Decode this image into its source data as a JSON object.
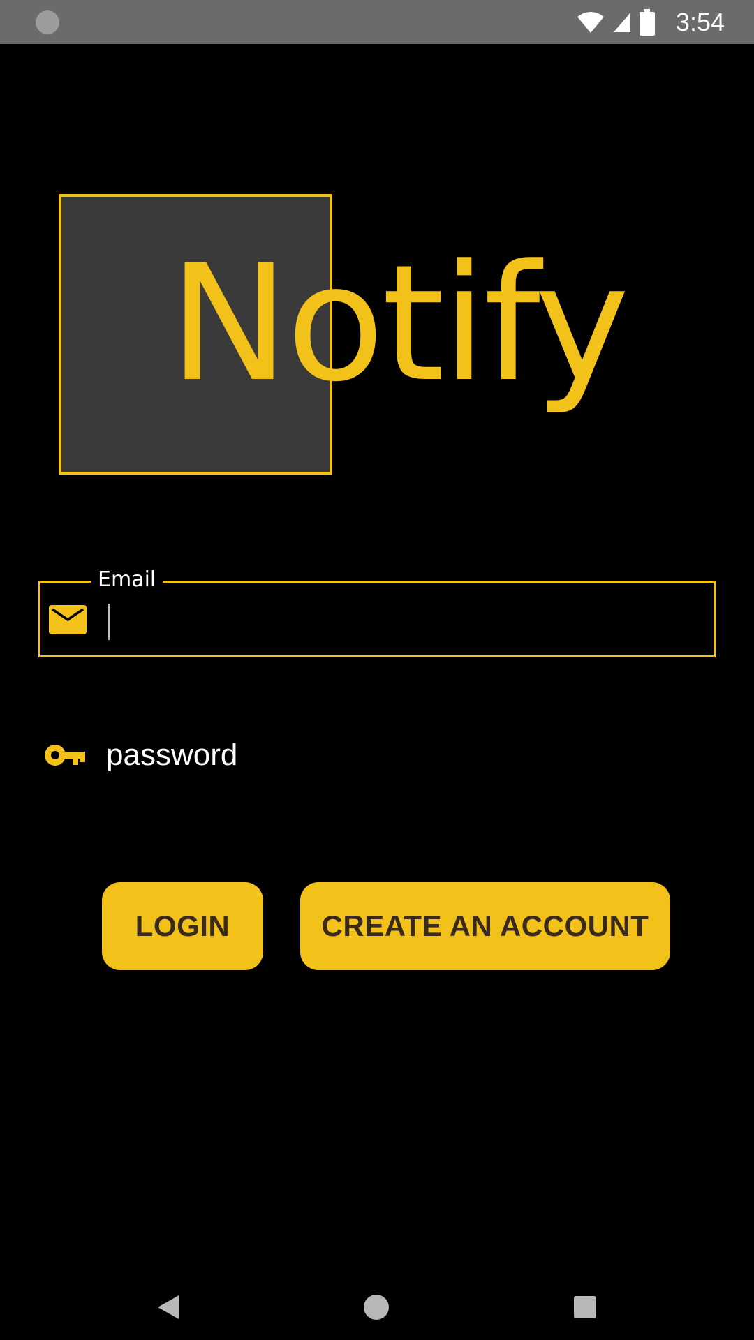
{
  "status_bar": {
    "time": "3:54",
    "icons": [
      "notification-dot-icon",
      "wifi-icon",
      "cell-signal-icon",
      "battery-icon"
    ]
  },
  "logo": {
    "text": "Notify",
    "color": "#f2c21a",
    "box_color": "#3a3a3a"
  },
  "login_form": {
    "email": {
      "label": "Email",
      "value": "",
      "icon": "mail-icon"
    },
    "password": {
      "placeholder": "password",
      "value": "",
      "icon": "key-icon"
    }
  },
  "buttons": {
    "login_label": "LOGIN",
    "create_account_label": "CREATE AN ACCOUNT"
  },
  "nav_bar": {
    "icons": [
      "back-icon",
      "home-icon",
      "recents-icon"
    ]
  },
  "colors": {
    "accent": "#f2c21a",
    "background": "#000000",
    "button_text": "#3a2a1e"
  }
}
